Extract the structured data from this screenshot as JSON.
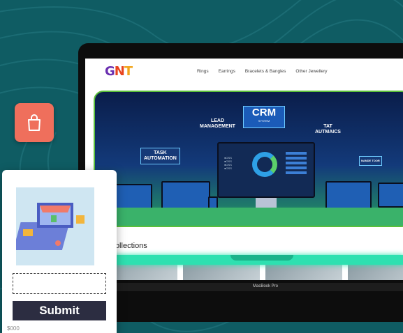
{
  "colors": {
    "background": "#0f5c63",
    "accent_bag": "#ef6f5c",
    "submit_bg": "#2c2d41",
    "glow": "#2ee0b0",
    "hero_border": "#5bbf3a"
  },
  "site": {
    "logo": {
      "g": "G",
      "n": "N",
      "t": "T"
    },
    "nav": [
      {
        "label": "Rings"
      },
      {
        "label": "Earrings"
      },
      {
        "label": "Bracelets & Bangles"
      },
      {
        "label": "Other Jewellery"
      }
    ],
    "hero": {
      "title": "CRM",
      "title_sub": "SYSTEM",
      "labels": {
        "lead": "LEAD\nMANAGEMENT",
        "task": "TASK\nAUTOMATION",
        "tat": "TAT\nAUTMAICS",
        "nano": "NANDE TOOR"
      },
      "monitor_list": [
        "●OSS",
        "●OSS",
        "●OSS",
        "●OSS"
      ]
    },
    "section_title": "w Collections"
  },
  "laptop": {
    "brand": "MacBook Pro"
  },
  "icons": {
    "bag": "shopping-bag-icon"
  },
  "card": {
    "input_value": "",
    "submit_label": "Submit",
    "price": "$000"
  }
}
